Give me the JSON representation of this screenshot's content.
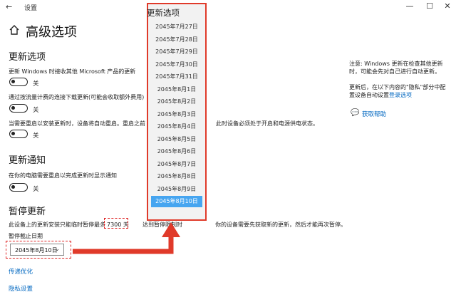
{
  "window": {
    "back_glyph": "←",
    "title": "设置",
    "min_glyph": "—",
    "max_glyph": "☐",
    "close_glyph": "✕"
  },
  "page": {
    "title": "高级选项"
  },
  "update_options": {
    "title": "更新选项",
    "ms_products_desc": "更新 Windows 时接收其他 Microsoft 产品的更新",
    "ms_products_state": "关",
    "metered_desc": "通过按流量计费的连接下载更新(可能会收取额外费用)",
    "metered_state": "关",
    "restart_desc": "当需要重启以安装更新时，设备将自动重启。重启之前",
    "restart_desc_tail": "此时设备必须处于开启和电源供电状态。",
    "restart_state": "关"
  },
  "notifications": {
    "title": "更新通知",
    "desc": "在你的电脑需要重启以完成更新时显示通知",
    "state": "关"
  },
  "pause": {
    "title": "暂停更新",
    "desc_prefix": "此设备上的更新安装只能临时暂停最多",
    "days_value": "7300 天",
    "desc_mid": "达到暂停限制时",
    "desc_suffix": "你的设备需要先获取新的更新，然后才能再次暂停。",
    "until_label": "暂停截止日期",
    "selected_date": "2045年8月10日"
  },
  "links": {
    "delivery_optimization": "传递优化",
    "privacy_settings": "隐私设置"
  },
  "side_notes": {
    "note1_line1": "注意: Windows 更新在检查其他更新",
    "note1_line2": "时，可能会先对自己进行自动更新。",
    "note2_line1": "更新后，在以下内容的\"隐私\"部分中配",
    "note2_line2_prefix": "置设备自动设置",
    "note2_link": "登录选项",
    "help_link": "获取帮助"
  },
  "dropdown": {
    "header": "更新选项",
    "items": [
      "2045年7月27日",
      "2045年7月28日",
      "2045年7月29日",
      "2045年7月30日",
      "2045年7月31日",
      "2045年8月1日",
      "2045年8月2日",
      "2045年8月3日",
      "2045年8月4日",
      "2045年8月5日",
      "2045年8月6日",
      "2045年8月7日",
      "2045年8月8日",
      "2045年8月9日",
      "2045年8月10日"
    ],
    "selected_index": 14
  },
  "colors": {
    "accent": "#0067c0",
    "highlight": "#46a5f0",
    "annotation_red": "#e03a2a"
  }
}
